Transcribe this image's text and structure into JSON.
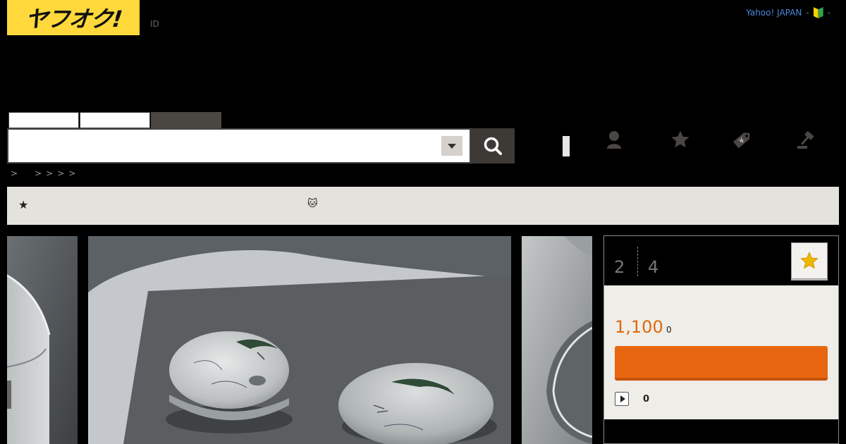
{
  "header": {
    "logo_text": "ヤフオク!",
    "id_link": "ID",
    "right_link": "Yahoo! JAPAN",
    "separator": "-",
    "beginner_icon": "beginner-mark-icon"
  },
  "search": {
    "tabs": [
      "",
      "",
      ""
    ],
    "placeholder": "",
    "value": "",
    "dropdown_icon": "chevron-down-icon",
    "submit_icon": "search-icon"
  },
  "nav_icons": [
    "user-icon",
    "star-icon",
    "tag-icon",
    "gavel-icon"
  ],
  "breadcrumb": [
    ">",
    ">",
    ">",
    ">",
    ">"
  ],
  "notice": {
    "star_glyph": "★",
    "emoji": "🐱"
  },
  "bid_panel": {
    "count_left": "2",
    "count_right": "4",
    "watch_icon": "star-icon",
    "price": "1,100",
    "price_sub": "0",
    "bid_button_label": "",
    "play_count": "0"
  },
  "colors": {
    "logo_yellow": "#ffd83c",
    "accent_orange": "#e8660f",
    "price_orange": "#e06812",
    "link_blue": "#4a89dc"
  }
}
